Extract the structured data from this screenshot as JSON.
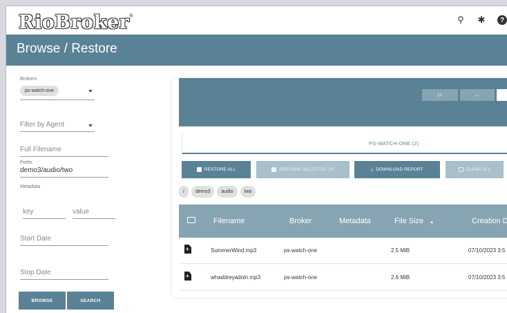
{
  "app": {
    "logo": "RioBroker",
    "logo_mark": "®"
  },
  "topbar": {
    "icons": [
      "search-icon",
      "gear-icon",
      "help-icon"
    ],
    "search_glyph": "⚲",
    "gear_glyph": "✱",
    "help_glyph": "?"
  },
  "page": {
    "title": "Browse / Restore"
  },
  "sidebar": {
    "brokers_label": "Brokers",
    "broker_selected": "ps-watch-one",
    "agent_placeholder": "Filter by Agent",
    "filename_placeholder": "Full Filename",
    "prefix_label": "Prefix",
    "prefix_value": "demo3/audio/two",
    "metadata_label": "Metadata",
    "key_placeholder": "key",
    "value_placeholder": "value",
    "start_date_placeholder": "Start Date",
    "stop_date_placeholder": "Stop Date",
    "browse_label": "BROWSE",
    "search_label": "SEARCH"
  },
  "pager": {
    "first": "|<",
    "prev": "←"
  },
  "tab": {
    "label": "PS-WATCH-ONE (2)"
  },
  "actions": {
    "restore_all": "RESTORE ALL",
    "restore_selected": "RESTORE SELECTED (0)",
    "download_report": "DOWNLOAD REPORT",
    "clear_all": "CLEAR ALL"
  },
  "breadcrumb": [
    "/",
    "demo3",
    "audio",
    "two"
  ],
  "table": {
    "columns": [
      "Filename",
      "Broker",
      "Metadata",
      "File Size",
      "Creation D"
    ],
    "sort_indicator": "▲",
    "rows": [
      {
        "filename": "SummerWind.mp3",
        "broker": "ps-watch-one",
        "metadata": "",
        "size": "2.5 MiB",
        "created": "07/10/2023 3:5"
      },
      {
        "filename": "whaddreyadoin.mp3",
        "broker": "ps-watch-one",
        "metadata": "",
        "size": "2.6 MiB",
        "created": "07/10/2023 3:5"
      }
    ]
  },
  "colors": {
    "primary": "#5a8296",
    "header_light": "#87a4b3",
    "disabled": "#a9bfca"
  }
}
